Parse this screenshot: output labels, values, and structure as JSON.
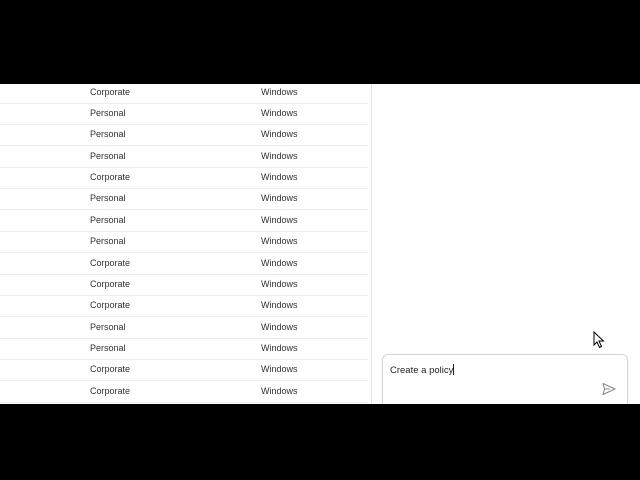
{
  "device_table": {
    "rows": [
      {
        "ownership": "Corporate",
        "os": "Windows"
      },
      {
        "ownership": "Personal",
        "os": "Windows"
      },
      {
        "ownership": "Personal",
        "os": "Windows"
      },
      {
        "ownership": "Personal",
        "os": "Windows"
      },
      {
        "ownership": "Corporate",
        "os": "Windows"
      },
      {
        "ownership": "Personal",
        "os": "Windows"
      },
      {
        "ownership": "Personal",
        "os": "Windows"
      },
      {
        "ownership": "Personal",
        "os": "Windows"
      },
      {
        "ownership": "Corporate",
        "os": "Windows"
      },
      {
        "ownership": "Corporate",
        "os": "Windows"
      },
      {
        "ownership": "Corporate",
        "os": "Windows"
      },
      {
        "ownership": "Personal",
        "os": "Windows"
      },
      {
        "ownership": "Personal",
        "os": "Windows"
      },
      {
        "ownership": "Corporate",
        "os": "Windows"
      },
      {
        "ownership": "Corporate",
        "os": "Windows"
      }
    ]
  },
  "copilot": {
    "prompt_value": "Create a policy",
    "send_icon": "send-icon"
  },
  "colors": {
    "text": "#323130",
    "divider": "#ececec",
    "send_icon": "#8a8886"
  }
}
